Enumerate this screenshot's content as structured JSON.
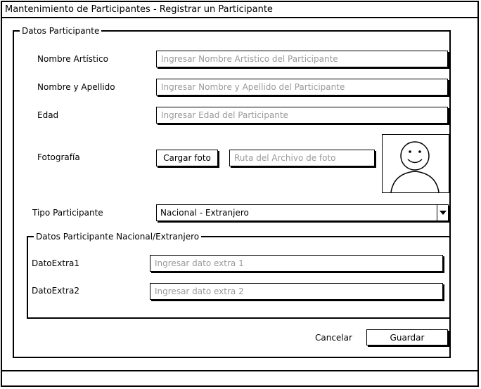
{
  "window": {
    "title": "Mantenimiento de Participantes - Registrar un Participante"
  },
  "participant_section": {
    "legend": "Datos Participante",
    "nombre_artistico": {
      "label": "Nombre Artístico",
      "placeholder": "Ingresar Nombre Artistico del Participante"
    },
    "nombre_apellido": {
      "label": "Nombre y Apellido",
      "placeholder": "Ingresar Nombre y Apellido del Participante"
    },
    "edad": {
      "label": "Edad",
      "placeholder": "Ingresar Edad del Participante"
    },
    "fotografia": {
      "label": "Fotografía",
      "upload_button": "Cargar foto",
      "path_placeholder": "Ruta del Archivo de foto",
      "preview_icon": "smiley-face-icon"
    },
    "tipo": {
      "label": "Tipo Participante",
      "selected": "Nacional - Extranjero"
    }
  },
  "extra_section": {
    "legend": "Datos Participante Nacional/Extranjero",
    "extra1": {
      "label": "DatoExtra1",
      "placeholder": "Ingresar dato extra 1"
    },
    "extra2": {
      "label": "DatoExtra2",
      "placeholder": "Ingresar dato extra 2"
    }
  },
  "actions": {
    "cancel_label": "Cancelar",
    "save_label": "Guardar"
  }
}
